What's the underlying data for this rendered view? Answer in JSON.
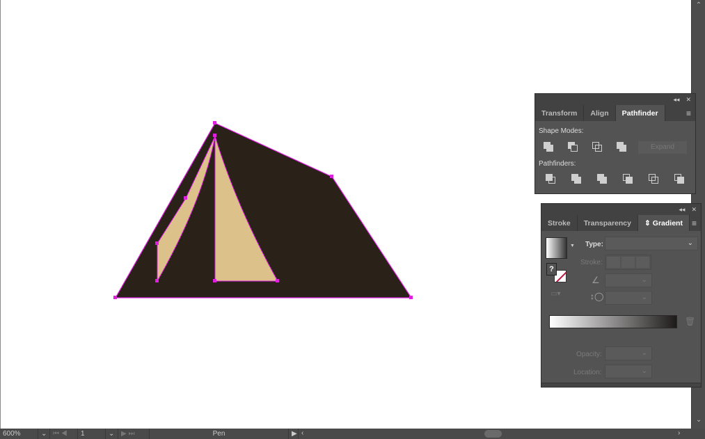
{
  "artwork": {
    "fill": "#2a2119",
    "accent": "#dcc18a",
    "selection": "#e020e0"
  },
  "pathfinder_panel": {
    "tabs": [
      "Transform",
      "Align",
      "Pathfinder"
    ],
    "active_tab": "Pathfinder",
    "shape_modes_label": "Shape Modes:",
    "expand_label": "Expand",
    "pathfinders_label": "Pathfinders:"
  },
  "gradient_panel": {
    "tabs": [
      "Stroke",
      "Transparency",
      "Gradient"
    ],
    "active_tab": "Gradient",
    "type_label": "Type:",
    "type_value": "",
    "stroke_label": "Stroke:",
    "opacity_label": "Opacity:",
    "location_label": "Location:",
    "unknown_mark": "?"
  },
  "status_bar": {
    "zoom": "600%",
    "artboard": "1",
    "tool": "Pen"
  }
}
